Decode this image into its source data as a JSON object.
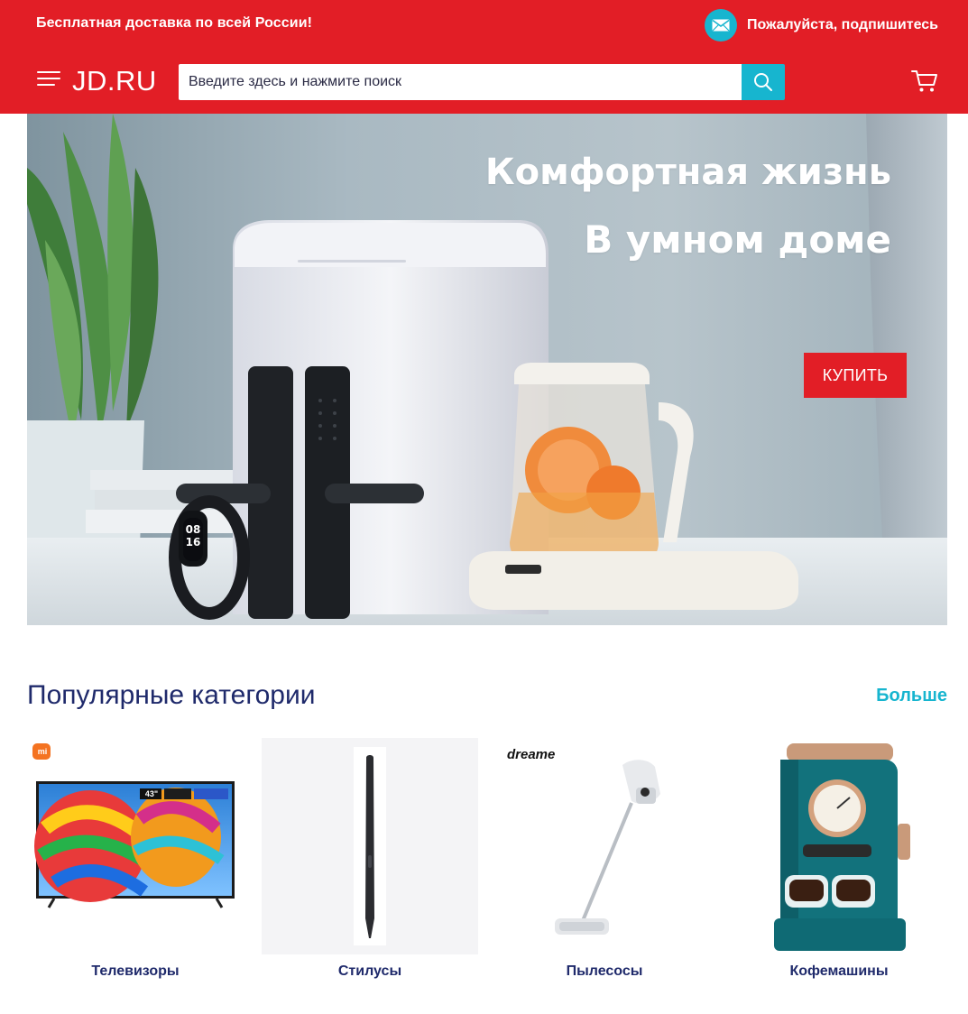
{
  "header": {
    "promo_text": "Бесплатная доставка по всей России!",
    "subscribe_label": "Пожалуйста, подпишитесь",
    "logo": "JD.RU",
    "search_placeholder": "Введите здесь и нажмите поиск"
  },
  "banner": {
    "title_line1": "Комфортная жизнь",
    "title_line2": "В умном доме",
    "buy_label": "КУПИТЬ",
    "watch_time_hours": "08",
    "watch_time_minutes": "16"
  },
  "categories": {
    "title": "Популярные категории",
    "more_label": "Больше",
    "items": [
      {
        "label": "Телевизоры",
        "brand": "mi",
        "tv_size_badge": "43\""
      },
      {
        "label": "Стилусы"
      },
      {
        "label": "Пылесосы",
        "brand": "dreame"
      },
      {
        "label": "Кофемашины"
      }
    ]
  },
  "colors": {
    "brand_red": "#e21e26",
    "accent_cyan": "#17b5cf",
    "text_navy": "#1f2a6b"
  }
}
